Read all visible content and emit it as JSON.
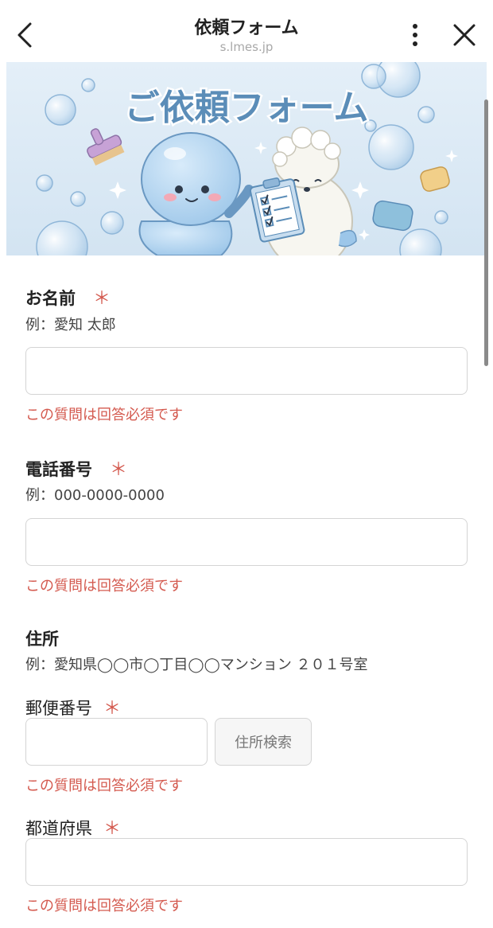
{
  "header": {
    "title": "依頼フォーム",
    "url": "s.lmes.jp"
  },
  "banner": {
    "title": "ご依頼フォーム"
  },
  "form": {
    "name": {
      "label": "お名前",
      "required_mark": "＊",
      "hint": "例：愛知 太郎",
      "value": "",
      "error": "この質問は回答必須です"
    },
    "phone": {
      "label": "電話番号",
      "required_mark": "＊",
      "hint": "例：000-0000-0000",
      "value": "",
      "error": "この質問は回答必須です"
    },
    "address": {
      "label": "住所",
      "hint": "例：愛知県◯◯市◯丁目◯◯マンション ２０１号室"
    },
    "postal": {
      "label": "郵便番号",
      "required_mark": "＊",
      "value": "",
      "search_button": "住所検索",
      "error": "この質問は回答必須です"
    },
    "prefecture": {
      "label": "都道府県",
      "required_mark": "＊",
      "value": "",
      "error": "この質問は回答必須です"
    }
  },
  "colors": {
    "error": "#d45a4f",
    "banner_bg": "#dbe9f5",
    "banner_title": "#5b8db8"
  }
}
